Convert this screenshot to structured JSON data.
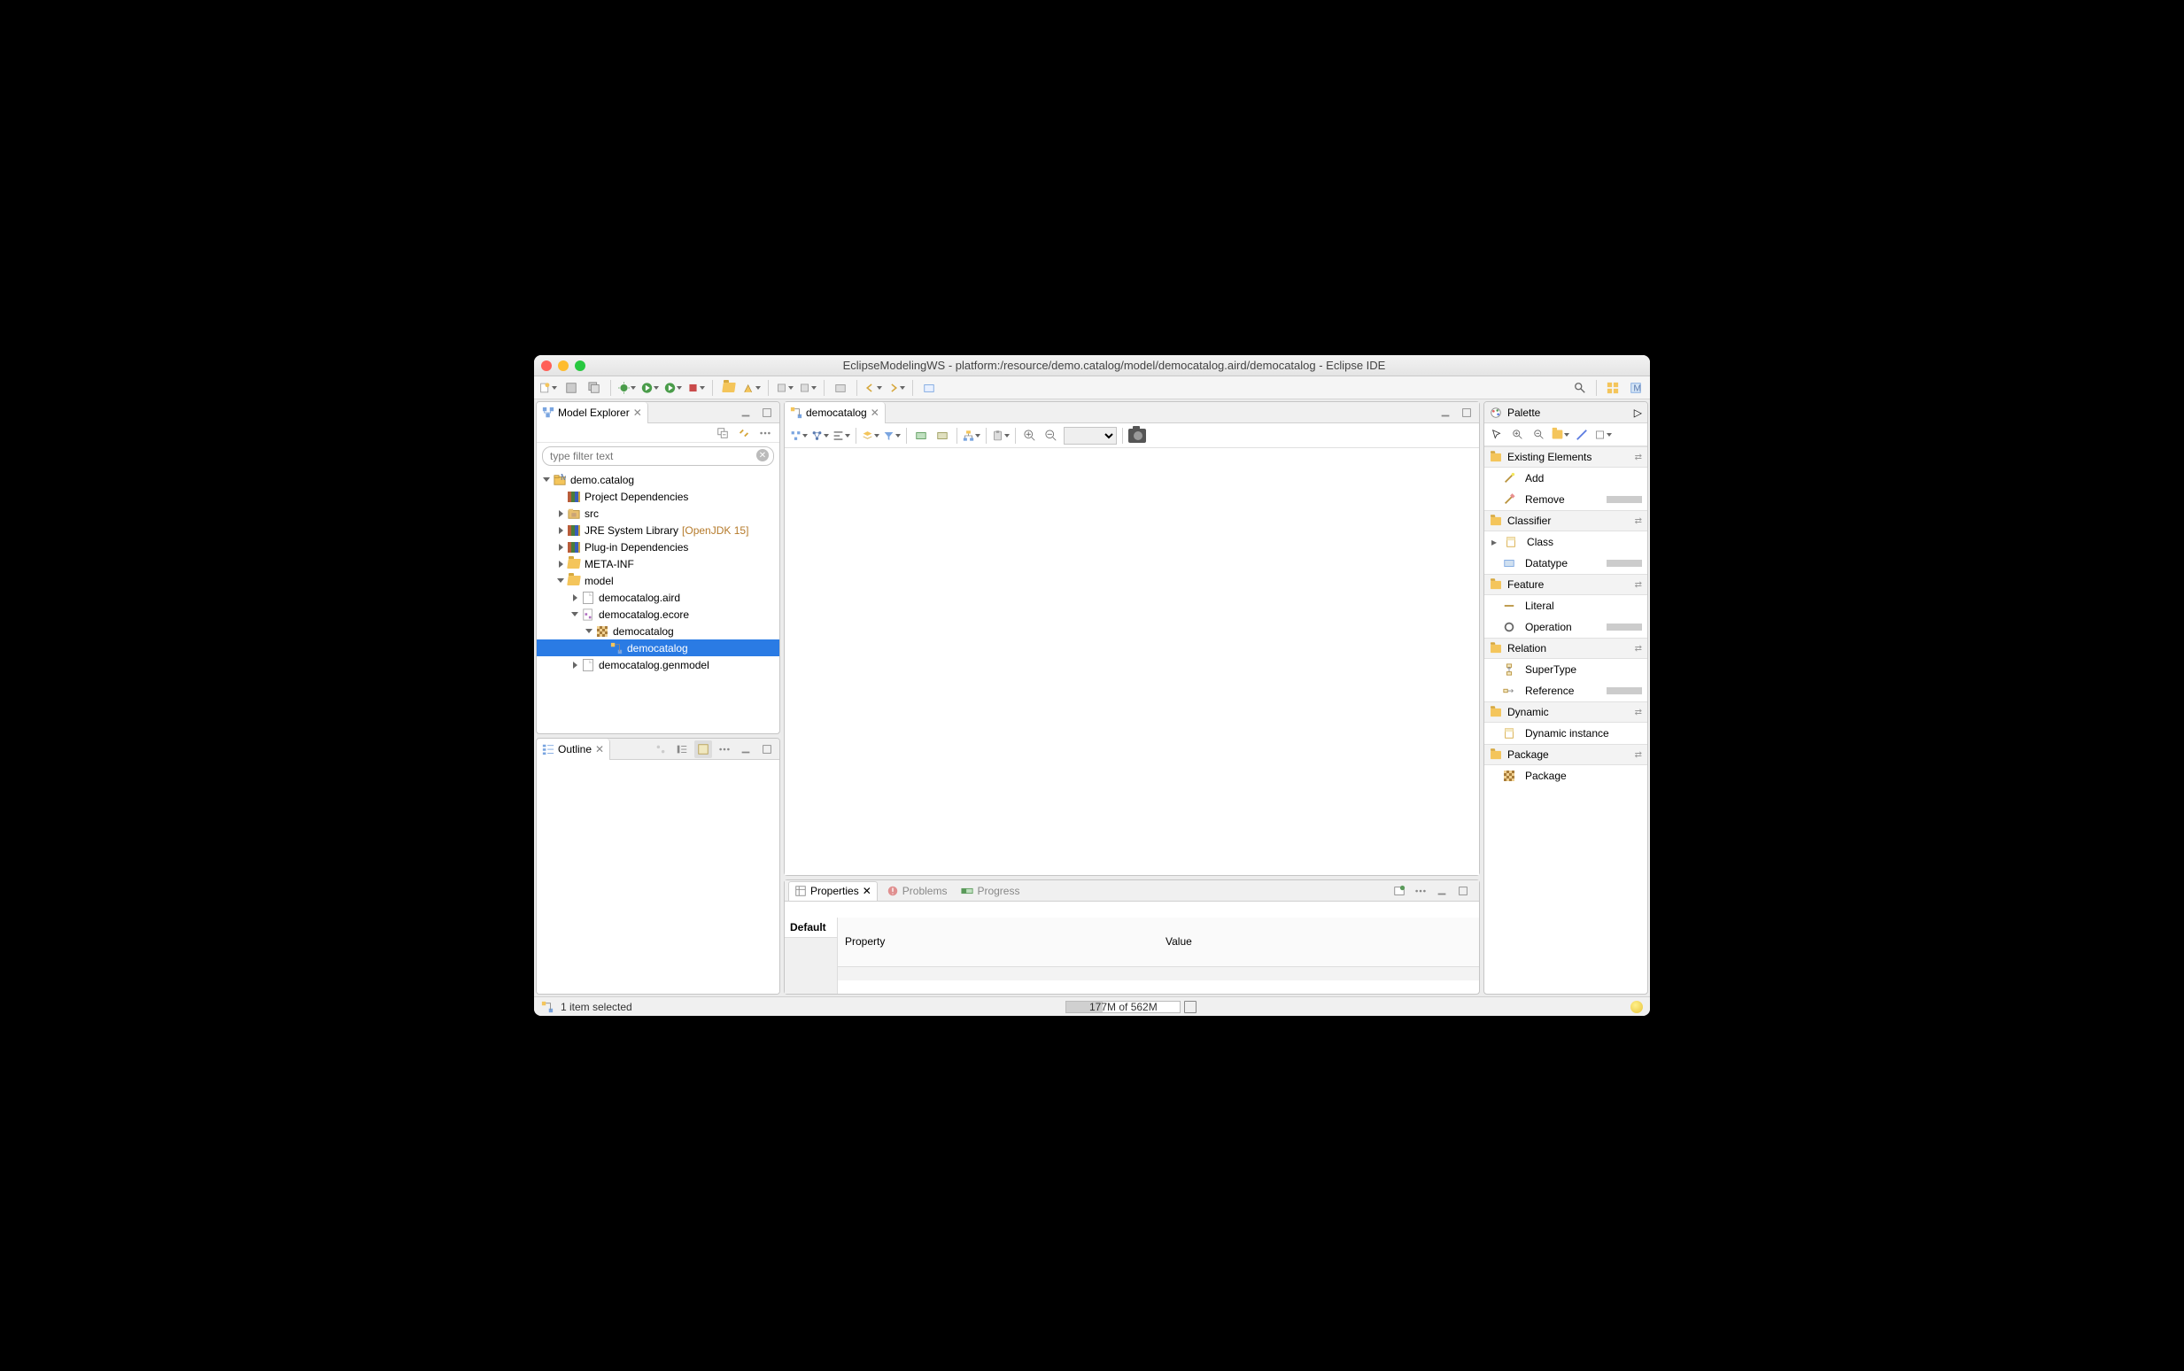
{
  "window_title": "EclipseModelingWS - platform:/resource/demo.catalog/model/democatalog.aird/democatalog - Eclipse IDE",
  "explorer": {
    "tab": "Model Explorer",
    "filter_placeholder": "type filter text",
    "items": [
      {
        "label": "demo.catalog",
        "level": 0,
        "expand": "open",
        "icon": "project"
      },
      {
        "label": "Project Dependencies",
        "level": 1,
        "expand": "none",
        "icon": "lib"
      },
      {
        "label": "src",
        "level": 1,
        "expand": "closed",
        "icon": "srcfolder"
      },
      {
        "label": "JRE System Library",
        "level": 1,
        "expand": "closed",
        "icon": "lib",
        "extra": "[OpenJDK 15]"
      },
      {
        "label": "Plug-in Dependencies",
        "level": 1,
        "expand": "closed",
        "icon": "lib"
      },
      {
        "label": "META-INF",
        "level": 1,
        "expand": "closed",
        "icon": "folder"
      },
      {
        "label": "model",
        "level": 1,
        "expand": "open",
        "icon": "folder"
      },
      {
        "label": "democatalog.aird",
        "level": 2,
        "expand": "closed",
        "icon": "file"
      },
      {
        "label": "democatalog.ecore",
        "level": 2,
        "expand": "open",
        "icon": "ecorefile"
      },
      {
        "label": "democatalog",
        "level": 3,
        "expand": "open",
        "icon": "grid"
      },
      {
        "label": "democatalog",
        "level": 4,
        "expand": "none",
        "icon": "pkg",
        "selected": true
      },
      {
        "label": "democatalog.genmodel",
        "level": 2,
        "expand": "closed",
        "icon": "file"
      }
    ]
  },
  "outline": {
    "tab": "Outline"
  },
  "editor": {
    "tab": "democatalog"
  },
  "palette": {
    "title": "Palette",
    "sections": [
      {
        "label": "Existing Elements",
        "items": [
          {
            "label": "Add",
            "icon": "wand"
          },
          {
            "label": "Remove",
            "icon": "eraser",
            "scroll": true
          }
        ]
      },
      {
        "label": "Classifier",
        "items": [
          {
            "label": "Class",
            "icon": "class",
            "expand": true
          },
          {
            "label": "Datatype",
            "icon": "datatype",
            "scroll": true
          }
        ]
      },
      {
        "label": "Feature",
        "items": [
          {
            "label": "Literal",
            "icon": "literal"
          },
          {
            "label": "Operation",
            "icon": "operation",
            "scroll": true
          }
        ]
      },
      {
        "label": "Relation",
        "items": [
          {
            "label": "SuperType",
            "icon": "supertype"
          },
          {
            "label": "Reference",
            "icon": "reference",
            "scroll": true
          }
        ]
      },
      {
        "label": "Dynamic",
        "items": [
          {
            "label": "Dynamic instance",
            "icon": "dynamic"
          }
        ]
      },
      {
        "label": "Package",
        "items": [
          {
            "label": "Package",
            "icon": "grid"
          }
        ]
      }
    ]
  },
  "bottom": {
    "tabs": [
      {
        "label": "Properties",
        "active": true
      },
      {
        "label": "Problems"
      },
      {
        "label": "Progress"
      }
    ],
    "columns": [
      "Property",
      "Value"
    ],
    "selected_category": "Default"
  },
  "status": {
    "selection": "1 item selected",
    "memory": "177M of 562M"
  }
}
